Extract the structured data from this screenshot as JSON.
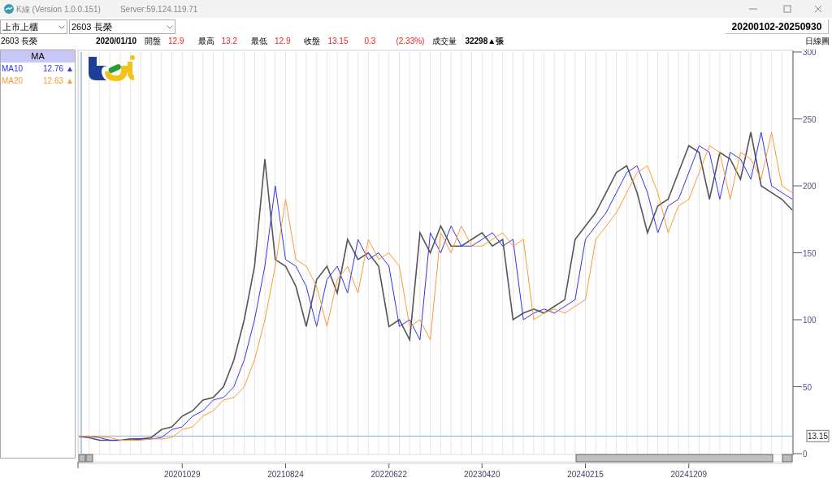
{
  "window": {
    "title": "K線 (Version 1.0.0.151)",
    "server": "Server:59.124.119.71"
  },
  "filters": [
    {
      "value": "上市上櫃"
    },
    {
      "value": "2603 長榮"
    }
  ],
  "date_range": "20200102-20250930",
  "quote": {
    "symbol": "2603 長榮",
    "date": "2020/01/10",
    "fields": [
      {
        "label": "開盤",
        "value": "12.9"
      },
      {
        "label": "最高",
        "value": "13.2"
      },
      {
        "label": "最低",
        "value": "12.9"
      },
      {
        "label": "收盤",
        "value": "13.15"
      }
    ],
    "change": "0.3",
    "change_pct": "(2.33%)",
    "volume_label": "成交量",
    "volume": "32298▲張"
  },
  "chart_type_label": "日線圖",
  "indicator_panel": {
    "title": "MA",
    "items": [
      {
        "name": "MA10",
        "value": "12.76",
        "arrow": "▲",
        "color": "#3333ee"
      },
      {
        "name": "MA20",
        "value": "12.63",
        "arrow": "▲",
        "color": "#ff9933"
      }
    ]
  },
  "chart": {
    "current_price_label": "13.15",
    "chart_data": {
      "type": "line",
      "categories": [
        null,
        null,
        null,
        null,
        null,
        null,
        null,
        null,
        null,
        null,
        "20201029",
        null,
        null,
        null,
        null,
        null,
        null,
        null,
        null,
        null,
        "20210824",
        null,
        null,
        null,
        null,
        null,
        null,
        null,
        null,
        null,
        "20220622",
        null,
        null,
        null,
        null,
        null,
        null,
        null,
        null,
        "20230420",
        null,
        null,
        null,
        null,
        null,
        null,
        null,
        null,
        null,
        "20240215",
        null,
        null,
        null,
        null,
        null,
        null,
        null,
        null,
        null,
        "20241209",
        null,
        null,
        null,
        null,
        null,
        null,
        null,
        null,
        null,
        null
      ],
      "ylim": [
        0,
        300
      ],
      "yticks": [
        0,
        50,
        100,
        150,
        200,
        250,
        300
      ],
      "grid": true,
      "ref_lines": [
        {
          "axis": "y",
          "value": 13.15
        }
      ],
      "series": [
        {
          "color": "#555555",
          "values": [
            13,
            12,
            10,
            10,
            10,
            11,
            11,
            12,
            18,
            20,
            28,
            32,
            40,
            42,
            50,
            70,
            100,
            140,
            220,
            145,
            140,
            125,
            95,
            130,
            140,
            120,
            160,
            145,
            150,
            140,
            95,
            100,
            85,
            165,
            150,
            170,
            155,
            155,
            160,
            165,
            155,
            160,
            100,
            105,
            108,
            105,
            110,
            115,
            160,
            170,
            180,
            195,
            210,
            215,
            195,
            165,
            185,
            190,
            210,
            230,
            225,
            190,
            225,
            220,
            205,
            240,
            200,
            195,
            190,
            182
          ]
        },
        {
          "color": "#3333ee",
          "values": [
            13,
            13,
            12,
            10,
            10,
            10,
            11,
            11,
            12,
            18,
            20,
            28,
            32,
            40,
            42,
            50,
            70,
            100,
            140,
            200,
            145,
            140,
            125,
            95,
            130,
            140,
            120,
            160,
            145,
            150,
            140,
            95,
            100,
            85,
            165,
            150,
            170,
            155,
            155,
            160,
            165,
            155,
            160,
            100,
            105,
            108,
            105,
            110,
            115,
            160,
            170,
            180,
            195,
            210,
            215,
            195,
            165,
            185,
            190,
            210,
            230,
            225,
            190,
            225,
            220,
            205,
            240,
            200,
            195,
            190
          ]
        },
        {
          "color": "#ff9933",
          "values": [
            13,
            13,
            13,
            12,
            10,
            10,
            10,
            11,
            11,
            12,
            18,
            20,
            28,
            32,
            40,
            42,
            50,
            70,
            100,
            140,
            190,
            145,
            140,
            125,
            95,
            130,
            140,
            120,
            160,
            145,
            150,
            140,
            95,
            100,
            85,
            165,
            150,
            170,
            155,
            155,
            160,
            165,
            155,
            160,
            100,
            105,
            108,
            105,
            110,
            115,
            160,
            170,
            180,
            195,
            210,
            215,
            195,
            165,
            185,
            190,
            210,
            230,
            225,
            190,
            225,
            220,
            205,
            240,
            200,
            195
          ]
        }
      ]
    }
  }
}
